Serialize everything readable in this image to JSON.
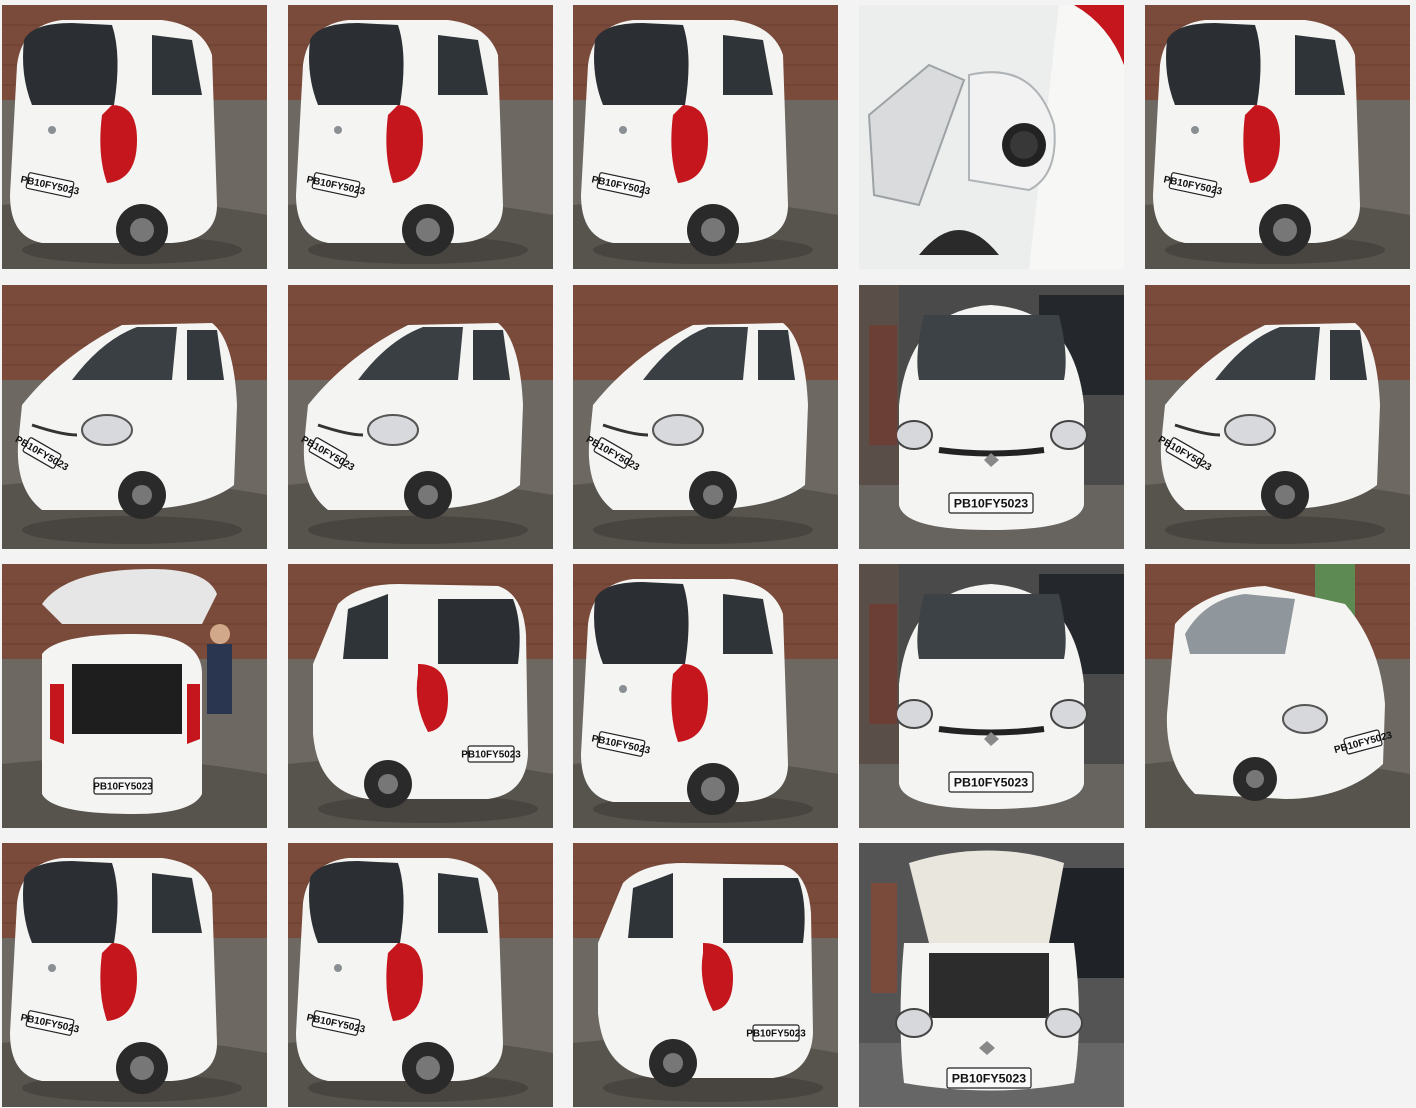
{
  "gallery": {
    "photos": [
      {
        "view": "rear-left",
        "plate": "PB10FY5023"
      },
      {
        "view": "rear-left",
        "plate": "PB10FY5023"
      },
      {
        "view": "rear-left",
        "plate": "PB10FY5023"
      },
      {
        "view": "fuel-cap",
        "plate": ""
      },
      {
        "view": "rear-left",
        "plate": "PB10FY5023"
      },
      {
        "view": "front-left",
        "plate": "PB10FY5023"
      },
      {
        "view": "front-left",
        "plate": "PB10FY5023"
      },
      {
        "view": "front-left",
        "plate": "PB10FY5023"
      },
      {
        "view": "front",
        "plate": "PB10FY5023"
      },
      {
        "view": "front-left",
        "plate": "PB10FY5023"
      },
      {
        "view": "boot-open",
        "plate": "PB10FY5023"
      },
      {
        "view": "rear-right",
        "plate": "PB10FY5023"
      },
      {
        "view": "rear-left",
        "plate": "PB10FY5023"
      },
      {
        "view": "front",
        "plate": "PB10FY5023"
      },
      {
        "view": "front-right",
        "plate": "PB10FY5023"
      },
      {
        "view": "rear-left",
        "plate": "PB10FY5023"
      },
      {
        "view": "rear-left",
        "plate": "PB10FY5023"
      },
      {
        "view": "rear-right",
        "plate": "PB10FY5023"
      },
      {
        "view": "bonnet-open",
        "plate": "PB10FY5023"
      }
    ]
  },
  "colors": {
    "page_background": "#f3f3f3",
    "car_body": "#f4f4f2",
    "tail_light": "#c4161c",
    "ground": "#5f5b55",
    "brick_wall": "#7a4a3a"
  }
}
